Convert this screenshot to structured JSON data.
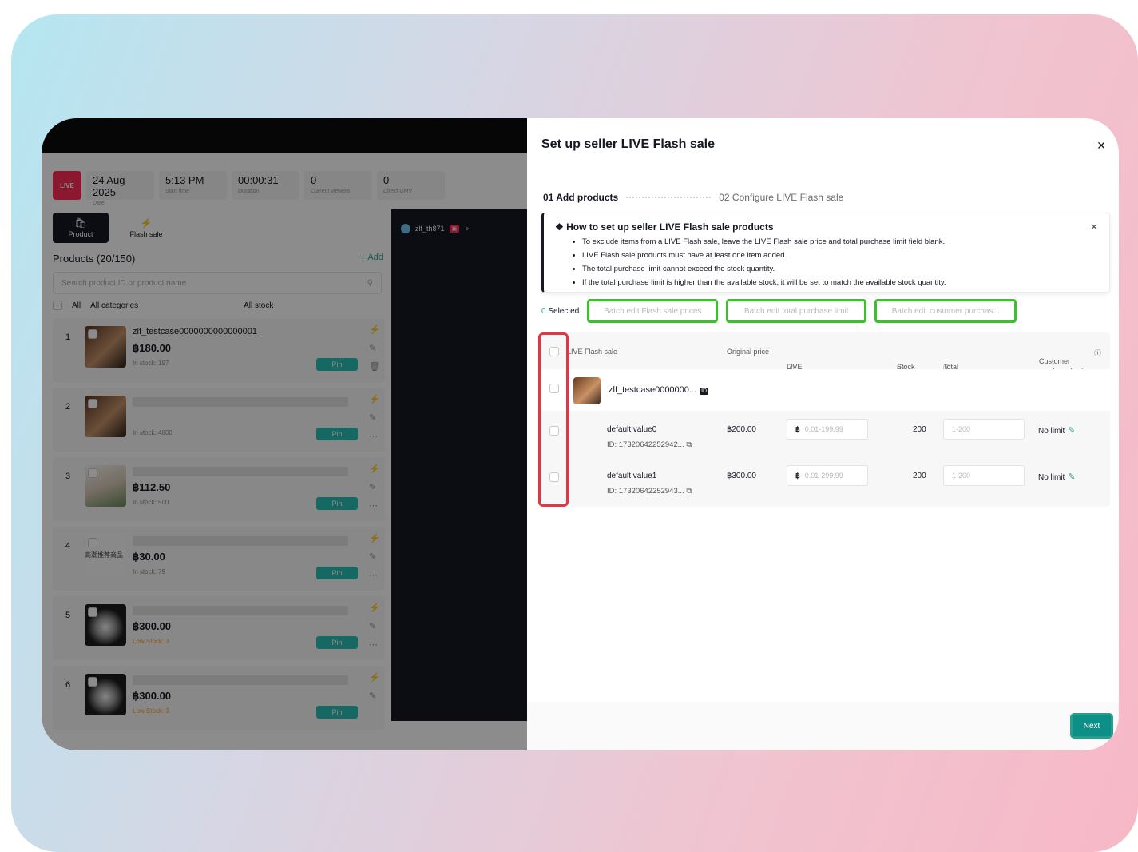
{
  "left": {
    "date": {
      "value": "24 Aug 2025",
      "label": "Date"
    },
    "start": {
      "value": "5:13 PM",
      "label": "Start time"
    },
    "duration": {
      "value": "00:00:31",
      "label": "Duration"
    },
    "viewers": {
      "value": "0",
      "label": "Current viewers"
    },
    "gmv": {
      "value": "0",
      "label": "Direct GMV"
    },
    "live_icon": "LIVE",
    "tabs": [
      {
        "label": "Product",
        "icon": "bag-icon"
      },
      {
        "label": "Flash sale",
        "icon": "flash-icon"
      }
    ],
    "products_title": "Products (20/150)",
    "add": "+ Add",
    "search_placeholder": "Search product ID or product name",
    "filter_all": "All",
    "filter_categories": "All categories",
    "filter_stock": "All stock",
    "host": "zlf_th871",
    "products": [
      {
        "num": "1",
        "name": "zlf_testcase0000000000000001",
        "price": "฿180.00",
        "stock": "In stock: 197",
        "pin": "Pin"
      },
      {
        "num": "2",
        "name": "",
        "price": "",
        "stock": "In stock: 4800",
        "pin": "Pin"
      },
      {
        "num": "3",
        "name": "",
        "price": "฿112.50",
        "stock": "In stock: 500",
        "pin": "Pin"
      },
      {
        "num": "4",
        "name": "",
        "price": "฿30.00",
        "stock": "In stock: 79",
        "pin": "Pin",
        "thumb_text": "高潮推荐商品"
      },
      {
        "num": "5",
        "name": "",
        "price": "฿300.00",
        "stock": "Low Stock: 3",
        "pin": "Pin"
      },
      {
        "num": "6",
        "name": "",
        "price": "฿300.00",
        "stock": "Low Stock: 3",
        "pin": "Pin"
      }
    ]
  },
  "modal": {
    "title": "Set up seller LIVE Flash sale",
    "step1": "01 Add products",
    "step2": "02 Configure LIVE Flash sale",
    "info_title": "How to set up seller LIVE Flash sale products",
    "info_items": [
      "To exclude items from a LIVE Flash sale, leave the LIVE Flash sale price and total purchase limit field blank.",
      "LIVE Flash sale products must have at least one item added.",
      "The total purchase limit cannot exceed the stock quantity.",
      "If the total purchase limit is higher than the available stock, it will be set to match the available stock quantity."
    ],
    "selected_count": "0",
    "selected_label": "Selected",
    "batch_price": "Batch edit Flash sale prices",
    "batch_total": "Batch edit total purchase limit",
    "batch_customer": "Batch edit customer purchas...",
    "columns": {
      "name": "LIVE Flash sale",
      "orig": "Original price",
      "flash": "LIVE Flash sale price",
      "stock": "Stock",
      "total": "Total purchase limit",
      "customer": "Customer purchase limit"
    },
    "group_name": "zlf_testcase0000000...",
    "group_tag": "ID",
    "variants": [
      {
        "name": "default value0",
        "id": "ID: 17320642252942...",
        "orig": "฿200.00",
        "currency": "฿",
        "price_ph": "0.01-199.99",
        "stock": "200",
        "limit_ph": "1-200",
        "customer": "No limit"
      },
      {
        "name": "default value1",
        "id": "ID: 17320642252943...",
        "orig": "฿300.00",
        "currency": "฿",
        "price_ph": "0.01-299.99",
        "stock": "200",
        "limit_ph": "1-200",
        "customer": "No limit"
      }
    ],
    "next": "Next"
  },
  "colors": {
    "accent": "#2a9d8f",
    "highlight_red": "#e23645",
    "highlight_green": "#3ac22d",
    "pin": "#28c0b2"
  }
}
